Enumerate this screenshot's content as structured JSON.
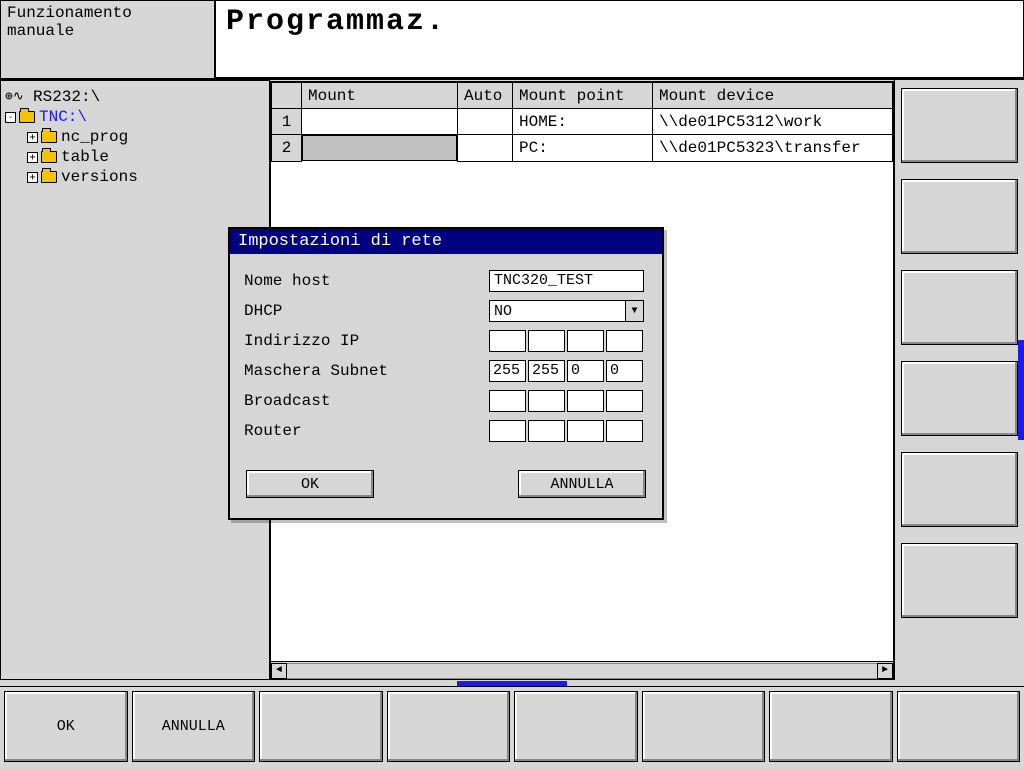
{
  "header": {
    "mode_left_line1": "Funzionamento",
    "mode_left_line2": "manuale",
    "title": "Programmaz."
  },
  "tree": {
    "rs232": "RS232:\\",
    "tnc": "TNC:\\",
    "children": [
      {
        "label": "nc_prog"
      },
      {
        "label": "table"
      },
      {
        "label": "versions"
      }
    ]
  },
  "mount_table": {
    "headers": {
      "c1": "Mount",
      "c2": "Auto",
      "c3": "Mount point",
      "c4": "Mount device"
    },
    "rows": [
      {
        "n": "1",
        "mount": "",
        "auto": "",
        "point": "HOME:",
        "device": "\\\\de01PC5312\\work"
      },
      {
        "n": "2",
        "mount": "",
        "auto": "",
        "point": "PC:",
        "device": "\\\\de01PC5323\\transfer"
      }
    ]
  },
  "dialog": {
    "title": "Impostazioni di rete",
    "labels": {
      "host": "Nome host",
      "dhcp": "DHCP",
      "ip": "Indirizzo IP",
      "subnet": "Maschera Subnet",
      "broadcast": "Broadcast",
      "router": "Router"
    },
    "values": {
      "host": "TNC320_TEST",
      "dhcp": "NO",
      "ip": [
        "",
        "",
        "",
        ""
      ],
      "subnet": [
        "255",
        "255",
        "0",
        "0"
      ],
      "broadcast": [
        "",
        "",
        "",
        ""
      ],
      "router": [
        "",
        "",
        "",
        ""
      ]
    },
    "buttons": {
      "ok": "OK",
      "cancel": "ANNULLA"
    }
  },
  "softkeys": {
    "bottom": [
      "OK",
      "ANNULLA",
      "",
      "",
      "",
      "",
      "",
      ""
    ]
  }
}
